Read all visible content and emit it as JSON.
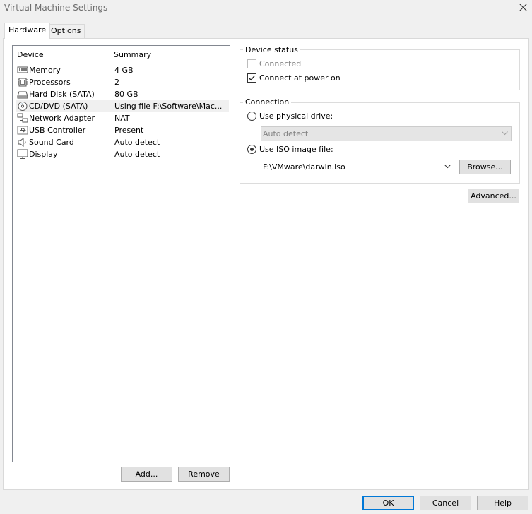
{
  "window": {
    "title": "Virtual Machine Settings"
  },
  "tabs": [
    {
      "label": "Hardware",
      "active": true
    },
    {
      "label": "Options",
      "active": false
    }
  ],
  "device_list": {
    "columns": [
      "Device",
      "Summary"
    ],
    "rows": [
      {
        "device": "Memory",
        "summary": "4 GB",
        "icon": "memory-icon"
      },
      {
        "device": "Processors",
        "summary": "2",
        "icon": "processor-icon"
      },
      {
        "device": "Hard Disk (SATA)",
        "summary": "80 GB",
        "icon": "hard-disk-icon"
      },
      {
        "device": "CD/DVD (SATA)",
        "summary": "Using file F:\\Software\\Mac...",
        "icon": "cd-dvd-icon",
        "selected": true
      },
      {
        "device": "Network Adapter",
        "summary": "NAT",
        "icon": "network-adapter-icon"
      },
      {
        "device": "USB Controller",
        "summary": "Present",
        "icon": "usb-icon"
      },
      {
        "device": "Sound Card",
        "summary": "Auto detect",
        "icon": "speaker-icon"
      },
      {
        "device": "Display",
        "summary": "Auto detect",
        "icon": "monitor-icon"
      }
    ]
  },
  "list_buttons": {
    "add": "Add...",
    "remove": "Remove"
  },
  "device_status": {
    "label": "Device status",
    "connected": {
      "label": "Connected",
      "checked": false,
      "disabled": true
    },
    "connect_at_power_on": {
      "label": "Connect at power on",
      "checked": true
    }
  },
  "connection": {
    "label": "Connection",
    "physical": {
      "label": "Use physical drive:",
      "selected": false,
      "value": "Auto detect"
    },
    "iso": {
      "label": "Use ISO image file:",
      "selected": true,
      "value": "F:\\VMware\\darwin.iso"
    },
    "browse": "Browse..."
  },
  "advanced": "Advanced...",
  "footer": {
    "ok": "OK",
    "cancel": "Cancel",
    "help": "Help"
  },
  "colors": {
    "accent": "#0078d7",
    "disabled_text": "#838383",
    "background": "#f0f0f0"
  }
}
